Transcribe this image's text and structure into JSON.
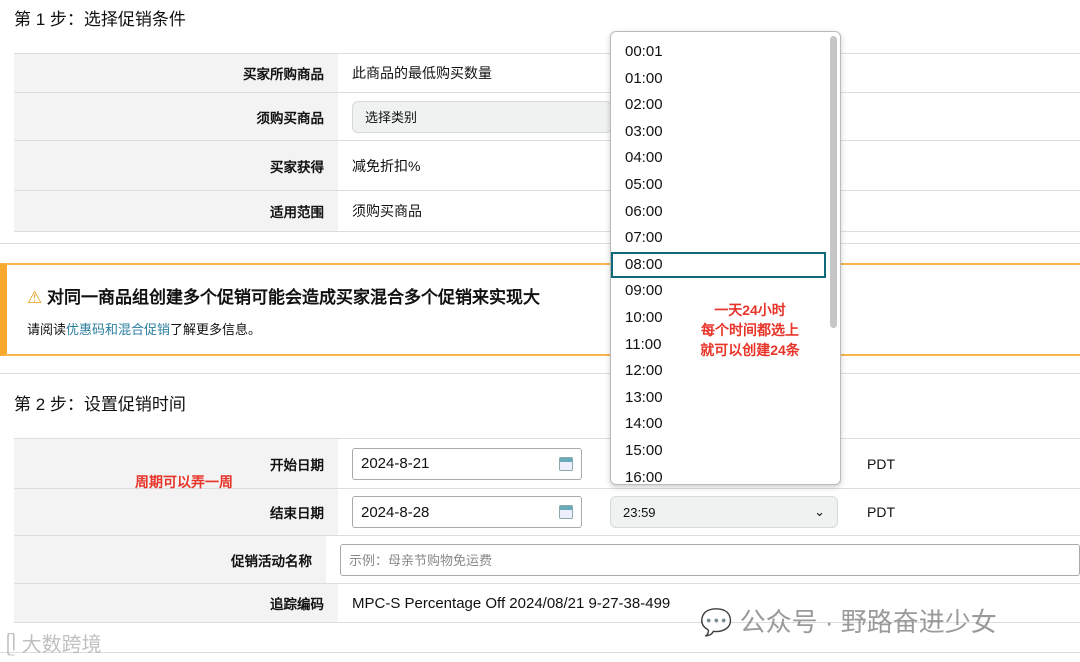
{
  "step1": {
    "title": "第 1 步：选择促销条件",
    "rows": [
      {
        "label": "买家所购商品",
        "value": "此商品的最低购买数量"
      },
      {
        "label": "须购买商品",
        "value": "选择类别"
      },
      {
        "label": "买家获得",
        "value": "减免折扣%"
      },
      {
        "label": "适用范围",
        "value": "须购买商品"
      }
    ]
  },
  "alert": {
    "icon": "warning-icon",
    "title": "对同一商品组创建多个促销可能会造成买家混合多个促销来实现大",
    "text_before": "请阅读",
    "link": "优惠码和混合促销",
    "text_after": "了解更多信息。"
  },
  "step2": {
    "title": "第 2 步：设置促销时间",
    "start": {
      "label": "开始日期",
      "date": "2024-8-21",
      "tz": "PDT"
    },
    "end": {
      "label": "结束日期",
      "date": "2024-8-28",
      "time": "23:59",
      "tz": "PDT"
    },
    "name": {
      "label": "促销活动名称",
      "placeholder": "示例：母亲节购物免运费"
    },
    "tracking": {
      "label": "追踪编码",
      "value": "MPC-S Percentage Off 2024/08/21 9-27-38-499"
    }
  },
  "dropdown": {
    "options": [
      "00:01",
      "01:00",
      "02:00",
      "03:00",
      "04:00",
      "05:00",
      "06:00",
      "07:00",
      "08:00",
      "09:00",
      "10:00",
      "11:00",
      "12:00",
      "13:00",
      "14:00",
      "15:00",
      "16:00"
    ],
    "highlighted": "08:00"
  },
  "annotations": {
    "period": "周期可以弄一周",
    "hours": [
      "一天24小时",
      "每个时间都选上",
      "就可以创建24条"
    ]
  },
  "watermarks": {
    "wechat": "公众号 · 野路奋进少女",
    "logo": "大数跨境"
  },
  "colors": {
    "accent": "#0e6a78",
    "alert": "#f7a92d",
    "annotation": "#e8352a",
    "link": "#2a7ea0"
  }
}
